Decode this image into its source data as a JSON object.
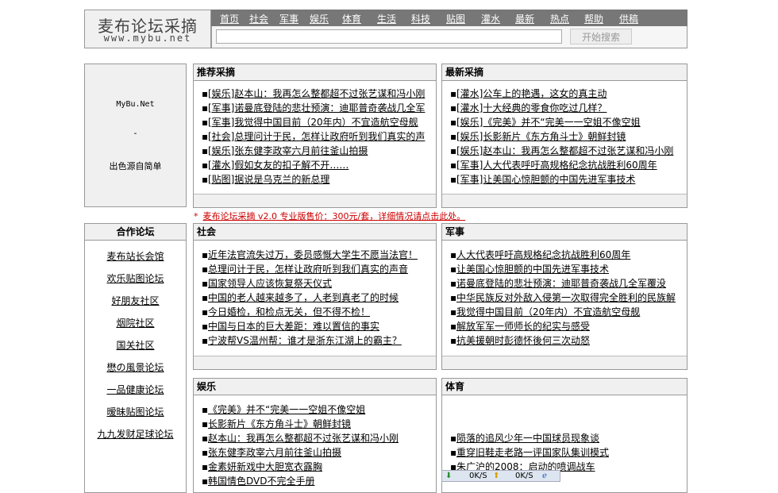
{
  "header": {
    "logo_title": "麦布论坛采摘",
    "logo_url": "www.mybu.net",
    "nav": [
      "首页",
      "社会",
      "军事",
      "娱乐",
      "体育",
      "生活",
      "科技",
      "贴图",
      "灌水",
      "最新",
      "热点",
      "帮助",
      "供稿"
    ],
    "search_button": "开始搜索"
  },
  "ad_box": {
    "site": "MyBu.Net",
    "dash": "-",
    "text": "出色源自简单"
  },
  "notice": {
    "star": "*",
    "text": "麦布论坛采摘 v2.0 专业版售价：300元/套，详细情况请点击此处。"
  },
  "partners": {
    "title": "合作论坛",
    "items": [
      "麦布站长会馆",
      "欢乐贴图论坛",
      "好朋友社区",
      "烟院社区",
      "国关社区",
      "懋の風景论坛",
      "一品健康论坛",
      "暧昧贴图论坛",
      "九九发财足球论坛"
    ]
  },
  "panels": {
    "recommended": {
      "title": "推荐采摘",
      "items": [
        "[娱乐]赵本山：我再怎么整都超不过张艺谋和冯小刚",
        "[军事]诺曼底登陆的悲壮预演：迪耶普奇袭战几全军",
        "[军事]我觉得中国目前（20年内）不宜造航空母舰",
        "[社会]总理问计于民，怎样让政府听到我们真实的声",
        "[娱乐]张东健李政宰六月前往釜山拍摄",
        "[灌水]假如女友的扣子解不开……",
        "[贴图]据说是乌克兰的新总理"
      ]
    },
    "latest": {
      "title": "最新采摘",
      "items": [
        "[灌水]公车上的艳遇，这女的真主动",
        "[灌水]十大经典的零食你吃过几样？",
        "[娱乐]《完美》并不“完美一一空姐不像空姐",
        "[娱乐]长影新片《东方角斗士》朝鲜封镜",
        "[娱乐]赵本山：我再怎么整都超不过张艺谋和冯小刚",
        "[军事]人大代表呼吁高规格纪念抗战胜利60周年",
        "[军事]让美国心惊胆颤的中国先进军事技术"
      ]
    },
    "society": {
      "title": "社会",
      "items": [
        "近年法官流失过万，委员感慨大学生不愿当法官！",
        "总理问计于民，怎样让政府听到我们真实的声音",
        "国家领导人应该恢复祭天仪式",
        "中国的老人越来越多了，人老到真老了的时候",
        "今日婚检，和检点无关，但不得不检！",
        "中国与日本的巨大差距：难以置信的事实",
        "宁波帮VS温州帮：谁才是浙东江湖上的霸主？"
      ]
    },
    "military": {
      "title": "军事",
      "items": [
        "人大代表呼吁高规格纪念抗战胜利60周年",
        "让美国心惊胆颤的中国先进军事技术",
        "诺曼底登陆的悲壮预演：迪耶普奇袭战几全军覆没",
        "中华民族反对外敌入侵第一次取得完全胜利的民族解",
        "我觉得中国目前（20年内）不宜造航空母舰",
        "解放军军一师师长的纪实与感受",
        "抗美援朝时彭德怀後何三次动怒"
      ]
    },
    "entertainment": {
      "title": "娱乐",
      "items": [
        "《完美》并不“完美一一空姐不像空姐",
        "长影新片《东方角斗士》朝鲜封镜",
        "赵本山：我再怎么整都超不过张艺谋和冯小刚",
        "张东健李政宰六月前往釜山拍摄",
        "金素妍新戏中大胆宽衣露胸",
        "韩国情色DVD不完全手册"
      ]
    },
    "sports": {
      "title": "体育",
      "items": [
        "陨落的追风少年一中国球员现象谈",
        "重穿旧鞋走老路一评国家队集训模式",
        "朱广沪的2008：启动的喷调战车"
      ]
    }
  },
  "status_widget": {
    "down": "0K/S",
    "up": "0K/S"
  }
}
